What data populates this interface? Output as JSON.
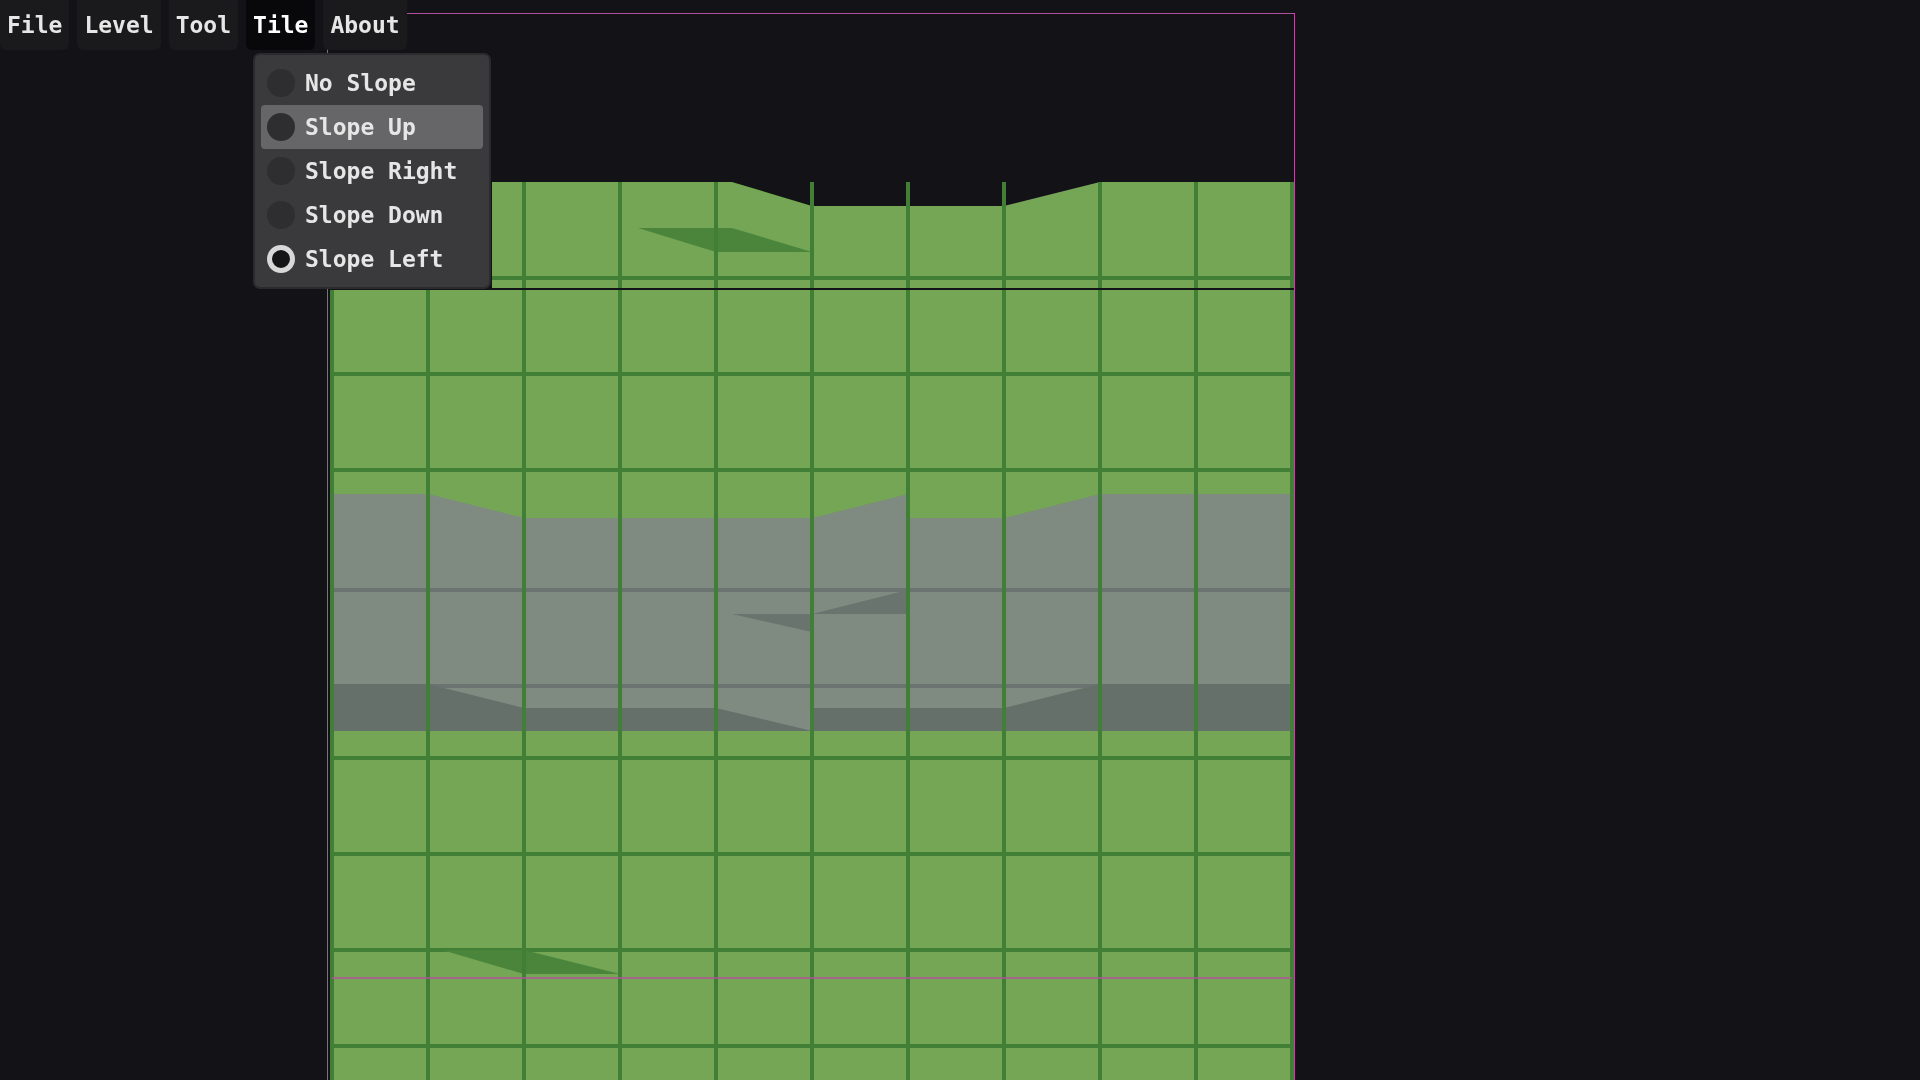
{
  "menu_bar": [
    {
      "label": "File",
      "selected": false
    },
    {
      "label": "Level",
      "selected": false
    },
    {
      "label": "Tool",
      "selected": false
    },
    {
      "label": "Tile",
      "selected": true
    },
    {
      "label": "About",
      "selected": false
    }
  ],
  "tile_menu": {
    "items": [
      {
        "label": "No Slope",
        "selected": false,
        "hovered": false
      },
      {
        "label": "Slope Up",
        "selected": false,
        "hovered": true
      },
      {
        "label": "Slope Right",
        "selected": false,
        "hovered": false
      },
      {
        "label": "Slope Down",
        "selected": false,
        "hovered": false
      },
      {
        "label": "Slope Left",
        "selected": true,
        "hovered": false
      }
    ]
  }
}
